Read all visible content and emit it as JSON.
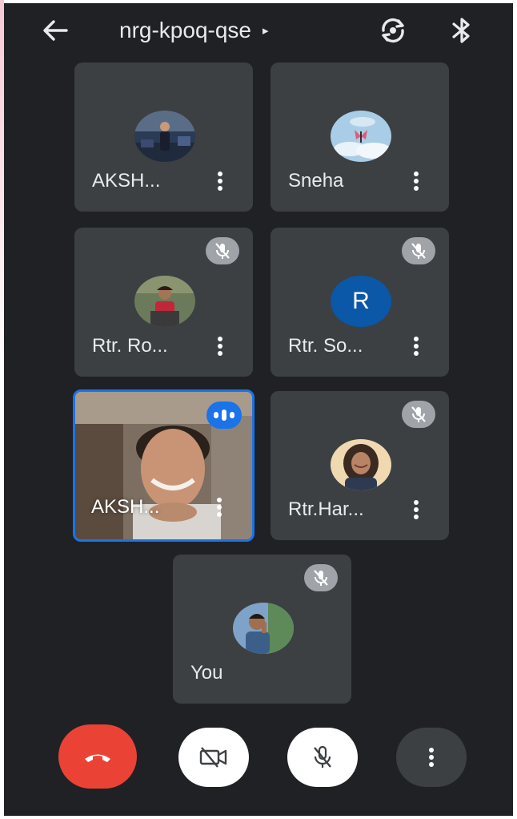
{
  "header": {
    "meeting_code": "nrg-kpoq-qse",
    "caret": "▸",
    "back_icon": "arrow-left-icon",
    "switch_camera_icon": "switch-camera-icon",
    "audio_icon": "bluetooth-icon"
  },
  "participants": [
    {
      "name": "AKSH...",
      "muted": false,
      "avatar": "photo"
    },
    {
      "name": "Sneha",
      "muted": false,
      "avatar": "photo"
    },
    {
      "name": "Rtr. Ro...",
      "muted": true,
      "avatar": "photo"
    },
    {
      "name": "Rtr. So...",
      "muted": true,
      "avatar": "letter",
      "initial": "R"
    },
    {
      "name": "AKSH...",
      "muted": false,
      "avatar": "video",
      "speaking": true
    },
    {
      "name": "Rtr.Har...",
      "muted": true,
      "avatar": "photo"
    },
    {
      "name": "You",
      "muted": true,
      "avatar": "photo"
    }
  ],
  "controls": {
    "end_call": "end-call-icon",
    "camera": "camera-off-icon",
    "microphone": "mic-off-icon",
    "more": "more-vertical-icon"
  },
  "colors": {
    "background": "#202124",
    "tile": "#3c4043",
    "accent": "#1a73e8",
    "end_call": "#ea4335",
    "avatar_letter_bg": "#0b57a8"
  }
}
